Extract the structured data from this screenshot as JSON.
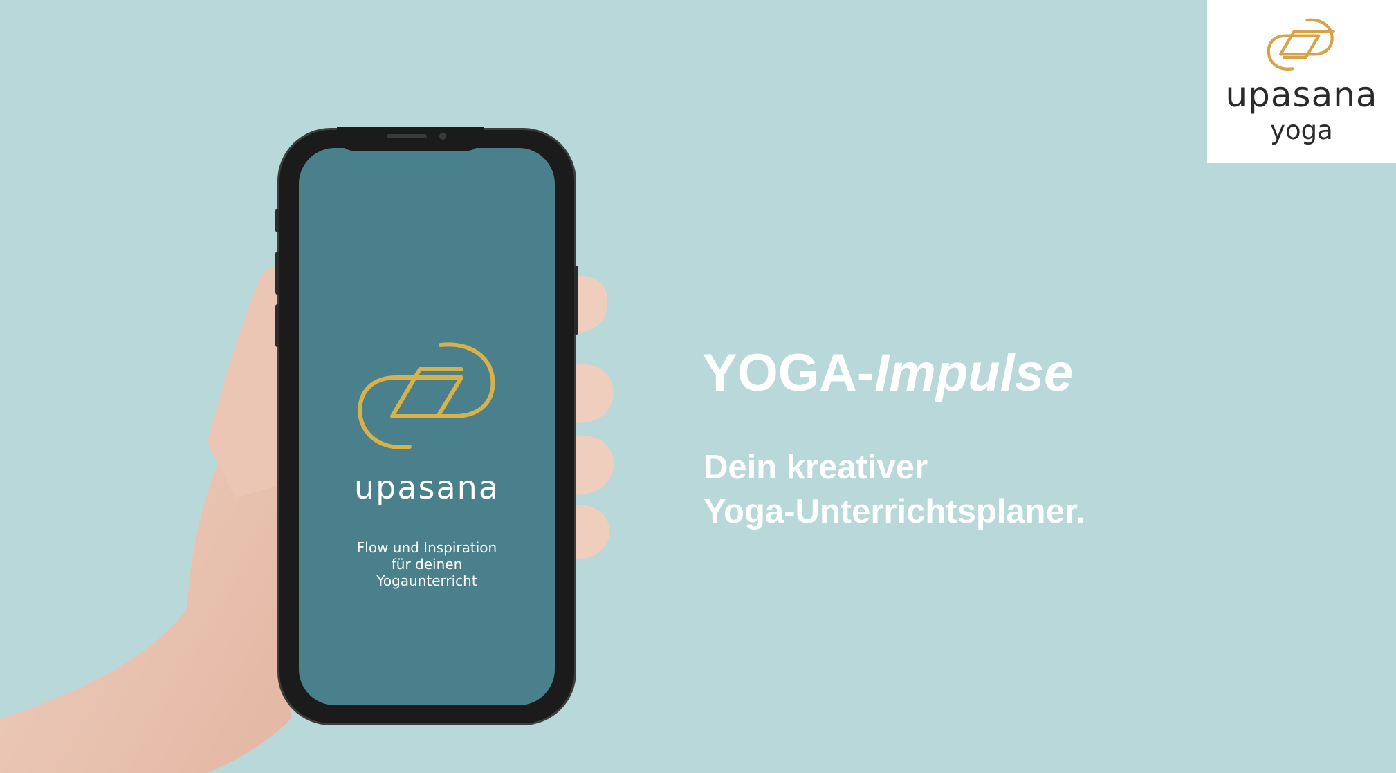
{
  "logo_card": {
    "brand": "upasana",
    "sub": "yoga",
    "mark_icon": "upasana-knot-logo-icon"
  },
  "phone": {
    "screen_brand": "upasana",
    "tagline_lines": [
      "Flow und Inspiration",
      "für deinen",
      "Yogaunterricht"
    ],
    "screen_color": "#4a808b",
    "mark_icon": "upasana-knot-logo-icon"
  },
  "headline": {
    "prefix": "YOGA-",
    "italic": "Impulse"
  },
  "subline": {
    "line1": "Dein kreativer",
    "line2": "Yoga-Unterrichtsplaner."
  },
  "colors": {
    "background": "#b9d8d9",
    "gold": "#d9b14a",
    "logo_gold": "#d4a446",
    "text": "#ffffff"
  }
}
